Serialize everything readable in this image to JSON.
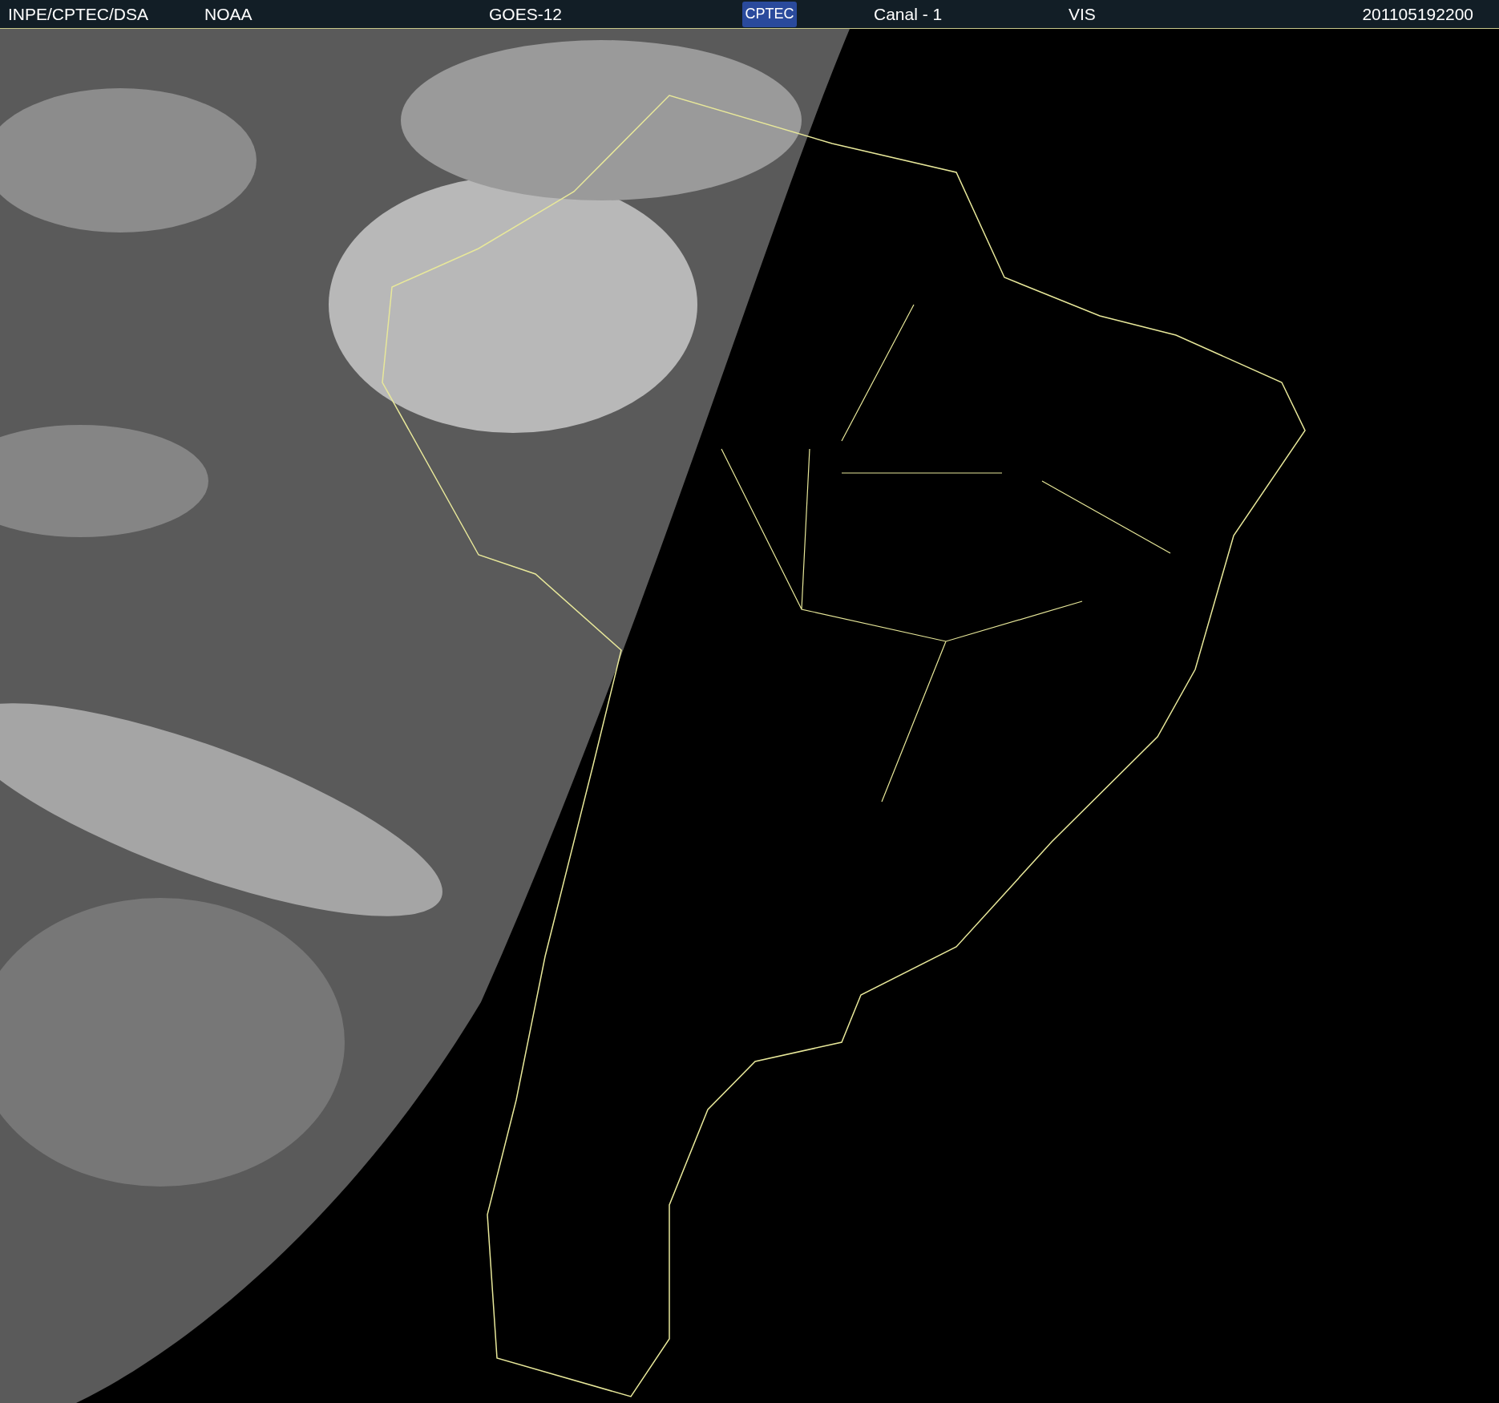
{
  "header": {
    "items": [
      "INPE/CPTEC/DSA",
      "NOAA",
      "GOES-12"
    ],
    "logo": "CPTEC",
    "items_right": [
      "Canal - 1",
      "VIS"
    ],
    "timestamp": "201105192200"
  }
}
